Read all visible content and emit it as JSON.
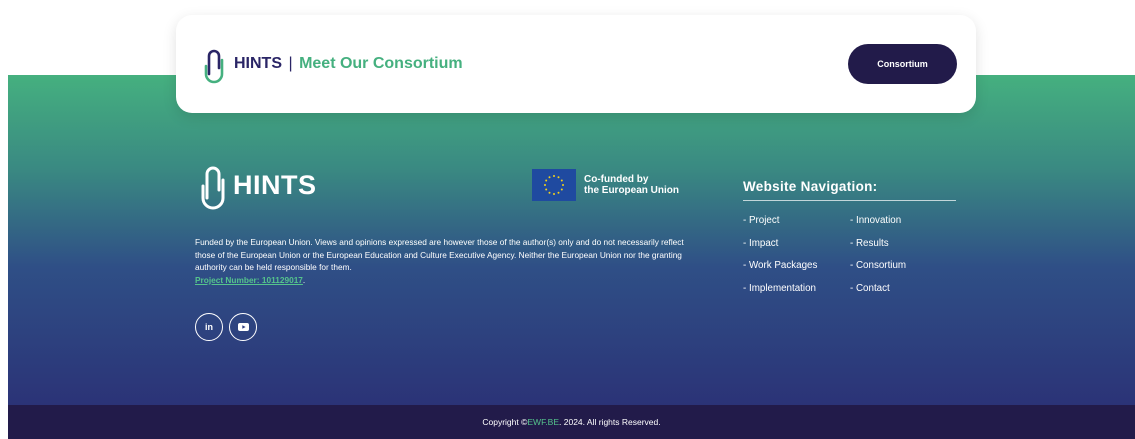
{
  "cta": {
    "brand": "HINTS",
    "separator": "|",
    "title": "Meet Our Consortium",
    "button_label": "Consortium"
  },
  "footer": {
    "brand": "HINTS",
    "eu": {
      "line1": "Co-funded by",
      "line2": "the European Union"
    },
    "disclaimer": "Funded by the European Union. Views and opinions expressed are however those of the author(s) only and do not necessarily reflect those of the European Union or the European Education and Culture Executive Agency. Neither the European Union nor the granting authority can be held responsible for them.",
    "project_link": "Project Number: 101129017",
    "project_suffix": ".",
    "socials": [
      {
        "icon": "linkedin-icon",
        "glyph": "in"
      },
      {
        "icon": "youtube-icon",
        "glyph": "▶"
      }
    ],
    "navigation": {
      "title": "Website Navigation:",
      "left": [
        "- Project",
        "- Impact",
        "- Work Packages",
        "- Implementation"
      ],
      "right": [
        "- Innovation",
        "- Results",
        "- Consortium",
        "- Contact"
      ]
    }
  },
  "copyright": {
    "prefix": "Copyright © ",
    "link": "EWF.BE",
    "suffix": ". 2024. All rights Reserved."
  },
  "colors": {
    "brand_navy": "#221b4a",
    "brand_green": "#45b07f",
    "eu_blue": "#1f4aa0"
  }
}
